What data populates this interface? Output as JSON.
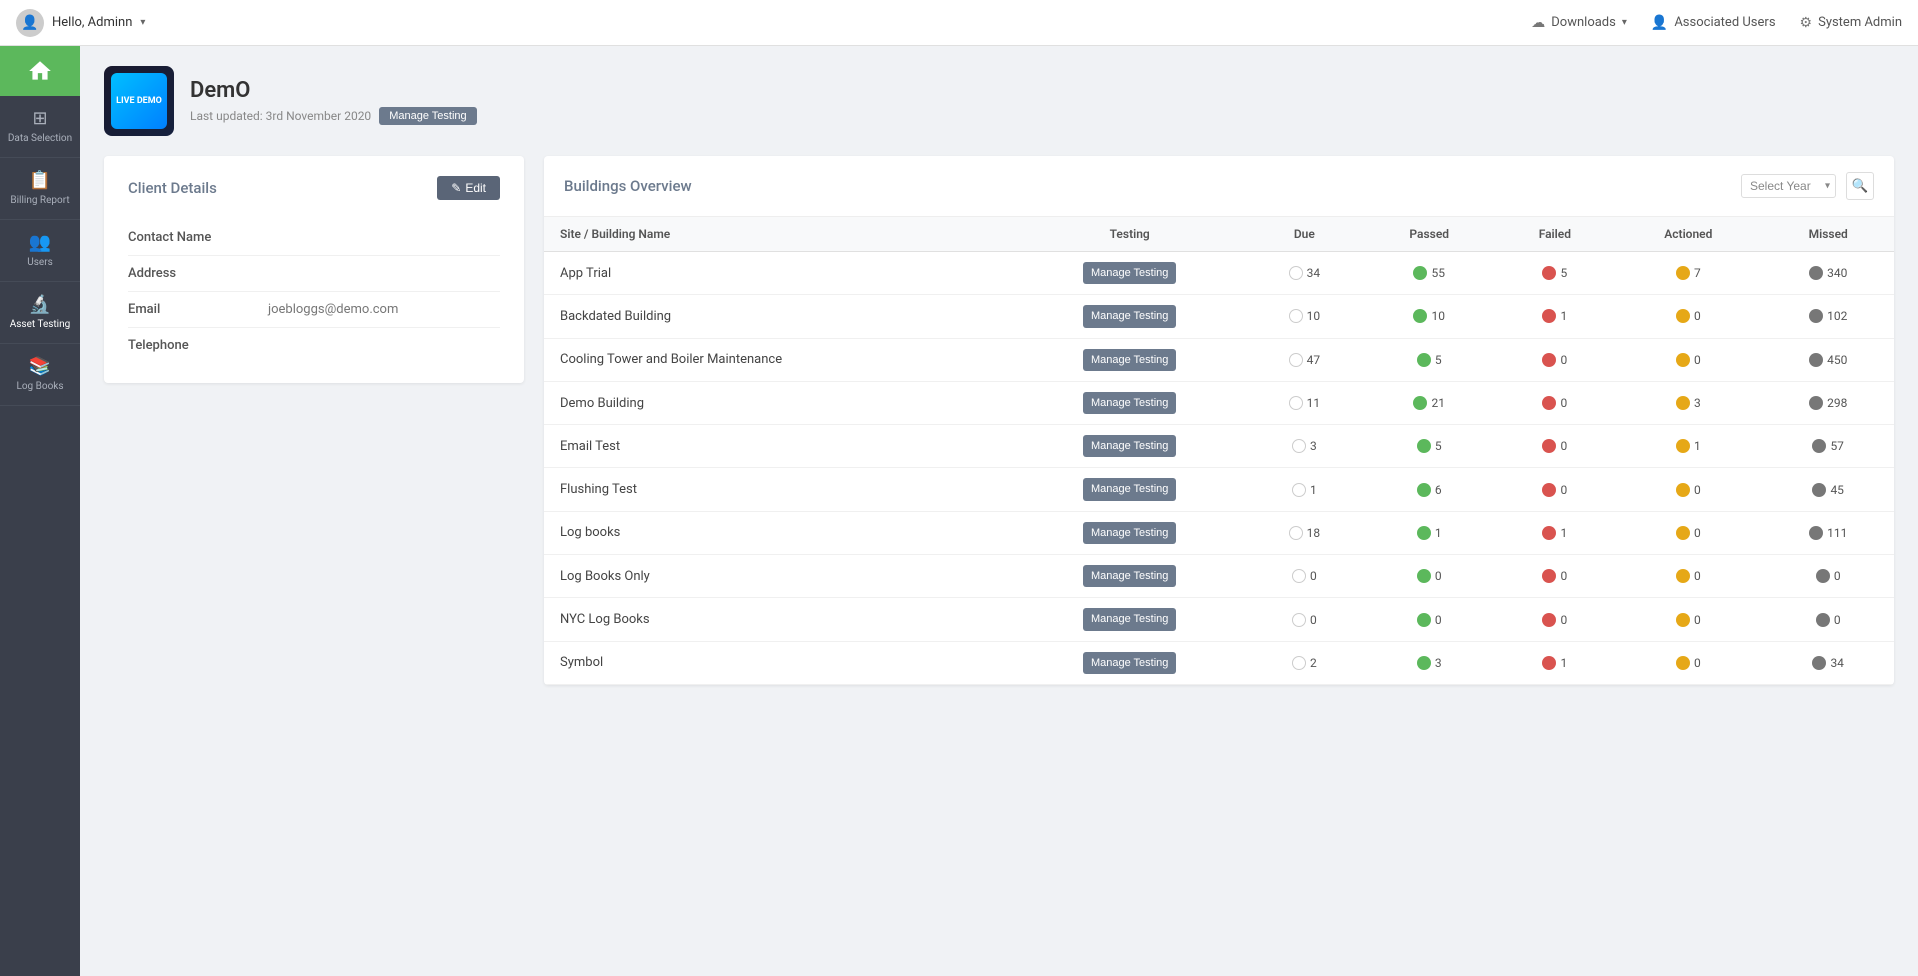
{
  "topNav": {
    "userLabel": "Hello, Adminn",
    "downloads": "Downloads",
    "associatedUsers": "Associated Users",
    "systemAdmin": "System Admin"
  },
  "sidebar": {
    "items": [
      {
        "id": "data-selection",
        "label": "Data Selection",
        "icon": "⊞"
      },
      {
        "id": "billing-report",
        "label": "Billing Report",
        "icon": "🧾"
      },
      {
        "id": "users",
        "label": "Users",
        "icon": "👥"
      },
      {
        "id": "asset-testing",
        "label": "Asset Testing",
        "icon": "🔬"
      },
      {
        "id": "log-books",
        "label": "Log Books",
        "icon": "📚"
      }
    ]
  },
  "client": {
    "name": "DemO",
    "lastUpdated": "Last updated: 3rd November 2020",
    "manageTestingLabel": "Manage Testing",
    "logoText": "LIVE DEMO"
  },
  "clientDetails": {
    "title": "Client Details",
    "editLabel": "Edit",
    "fields": [
      {
        "label": "Contact Name",
        "value": ""
      },
      {
        "label": "Address",
        "value": ""
      },
      {
        "label": "Email",
        "value": "joebloggs@demo.com"
      },
      {
        "label": "Telephone",
        "value": ""
      }
    ]
  },
  "buildingsOverview": {
    "title": "Buildings Overview",
    "selectYearPlaceholder": "Select Year",
    "columns": [
      "Site / Building Name",
      "Testing",
      "Due",
      "Passed",
      "Failed",
      "Actioned",
      "Missed"
    ],
    "rows": [
      {
        "name": "App Trial",
        "due": 34,
        "passed": 55,
        "failed": 5,
        "actioned": 7,
        "missed": 340
      },
      {
        "name": "Backdated Building",
        "due": 10,
        "passed": 10,
        "failed": 1,
        "actioned": 0,
        "missed": 102
      },
      {
        "name": "Cooling Tower and Boiler Maintenance",
        "due": 47,
        "passed": 5,
        "failed": 0,
        "actioned": 0,
        "missed": 450
      },
      {
        "name": "Demo Building",
        "due": 11,
        "passed": 21,
        "failed": 0,
        "actioned": 3,
        "missed": 298
      },
      {
        "name": "Email Test",
        "due": 3,
        "passed": 5,
        "failed": 0,
        "actioned": 1,
        "missed": 57
      },
      {
        "name": "Flushing Test",
        "due": 1,
        "passed": 6,
        "failed": 0,
        "actioned": 0,
        "missed": 45
      },
      {
        "name": "Log books",
        "due": 18,
        "passed": 1,
        "failed": 1,
        "actioned": 0,
        "missed": 111
      },
      {
        "name": "Log Books Only",
        "due": 0,
        "passed": 0,
        "failed": 0,
        "actioned": 0,
        "missed": 0
      },
      {
        "name": "NYC Log Books",
        "due": 0,
        "passed": 0,
        "failed": 0,
        "actioned": 0,
        "missed": 0
      },
      {
        "name": "Symbol",
        "due": 2,
        "passed": 3,
        "failed": 1,
        "actioned": 0,
        "missed": 34
      }
    ],
    "manageTestingLabel": "Manage Testing"
  }
}
